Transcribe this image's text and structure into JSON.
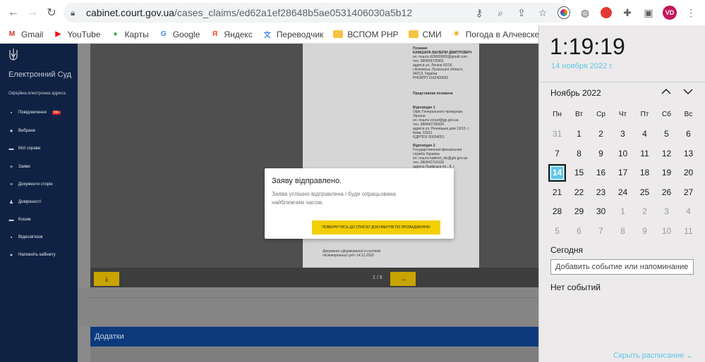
{
  "browser": {
    "url_host": "cabinet.court.gov.ua",
    "url_path": "/cases_claims/ed62a1ef28648b5ae0531406030a5b12",
    "avatar_initials": "VD"
  },
  "bookmarks": [
    {
      "label": "Gmail",
      "icon": "gmail-icon",
      "color": "#d93025",
      "glyph": "M"
    },
    {
      "label": "YouTube",
      "icon": "youtube-icon",
      "color": "#ff0000",
      "glyph": "▶"
    },
    {
      "label": "Карты",
      "icon": "maps-icon",
      "color": "#34a853",
      "glyph": "●"
    },
    {
      "label": "Google",
      "icon": "google-icon",
      "color": "#4285f4",
      "glyph": "G"
    },
    {
      "label": "Яндекс",
      "icon": "yandex-icon",
      "color": "#fc3f1d",
      "glyph": "Я"
    },
    {
      "label": "Переводчик",
      "icon": "translate-icon",
      "color": "#4285f4",
      "glyph": "文"
    },
    {
      "label": "ВСПОМ РНР",
      "icon": "folder-icon",
      "color": "#f6c343",
      "glyph": ""
    },
    {
      "label": "СМИ",
      "icon": "folder-icon",
      "color": "#f6c343",
      "glyph": ""
    },
    {
      "label": "Погода в Алчевске",
      "icon": "weather-icon",
      "color": "#f4a300",
      "glyph": "☀"
    }
  ],
  "site": {
    "title": "Електронний Суд",
    "subtitle": "Офіційна електронна адреса",
    "menu": [
      {
        "label": "Повідомлення",
        "icon": "message-icon",
        "glyph": "▪",
        "badge": "99+"
      },
      {
        "label": "Вибране",
        "icon": "star-icon",
        "glyph": "★",
        "badge": ""
      },
      {
        "label": "Мої справи",
        "icon": "folder-icon",
        "glyph": "▬",
        "badge": ""
      },
      {
        "label": "Заяви",
        "icon": "list-icon",
        "glyph": "≡",
        "badge": ""
      },
      {
        "label": "Документи сторін",
        "icon": "documents-icon",
        "glyph": "≡",
        "badge": ""
      },
      {
        "label": "Довіреності",
        "icon": "people-icon",
        "glyph": "♟",
        "badge": ""
      },
      {
        "label": "Кошик",
        "icon": "cart-icon",
        "glyph": "▬",
        "badge": ""
      },
      {
        "label": "Відеозв'язок",
        "icon": "video-icon",
        "glyph": "▪",
        "badge": ""
      },
      {
        "label": "Наповніть кабінету",
        "icon": "user-icon",
        "glyph": "●",
        "badge": ""
      }
    ]
  },
  "document": {
    "page_counter": "1 / 9",
    "lines": [
      "Позивач",
      "КАМШАРА ВАЛЕРІЙ ДМИТРОВИЧ",
      "ел. пошта d26009002@gmail.com",
      "тел. 380509725901",
      "адреса ул. Леніна б2/16",
      "г.Алчевськ, Луганської області,",
      "94213, Україна",
      "РНОКПП 2162400592",
      "Представник позивача",
      "Відповідач 1",
      "Офіс Генерального прокурора",
      "України",
      "ел. пошта vcourt@gp.gov.ua",
      "тел. 380442706624",
      "адреса ул. Резницька дом 13/15, г.",
      "Киев, 01011",
      "ЄДРПОУ 00034051",
      "Відповідач 2",
      "Государственная фискальная",
      "служба Украины",
      "ел. пошта kabinet_dis@gfs.gov.ua",
      "тел. 380442724109",
      "адреса Львівська пл., 8, г.",
      "Документ сформований в системі",
      "«Електронний суд» 14.11.2022"
    ]
  },
  "addons_label": "Додатки",
  "modal": {
    "title": "Заяву відправлено.",
    "text": "Заява успішно відправлена і буде опрацьована найближчим часом.",
    "button": "ПОВЕРНУТИСЬ ДО СПИСКУ ДОКУМЕНТІВ ПО ПРОВАДЖЕННЮ"
  },
  "clock": {
    "time": "1:19:19",
    "date": "14 ноября 2022 г.",
    "month": "Ноябрь 2022",
    "weekdays": [
      "Пн",
      "Вт",
      "Ср",
      "Чт",
      "Пт",
      "Сб",
      "Вс"
    ],
    "days": [
      {
        "d": "31",
        "dim": true
      },
      {
        "d": "1"
      },
      {
        "d": "2"
      },
      {
        "d": "3"
      },
      {
        "d": "4"
      },
      {
        "d": "5"
      },
      {
        "d": "6"
      },
      {
        "d": "7"
      },
      {
        "d": "8"
      },
      {
        "d": "9"
      },
      {
        "d": "10"
      },
      {
        "d": "11"
      },
      {
        "d": "12"
      },
      {
        "d": "13"
      },
      {
        "d": "14",
        "today": true
      },
      {
        "d": "15"
      },
      {
        "d": "16"
      },
      {
        "d": "17"
      },
      {
        "d": "18"
      },
      {
        "d": "19"
      },
      {
        "d": "20"
      },
      {
        "d": "21"
      },
      {
        "d": "22"
      },
      {
        "d": "23"
      },
      {
        "d": "24"
      },
      {
        "d": "25"
      },
      {
        "d": "26"
      },
      {
        "d": "27"
      },
      {
        "d": "28"
      },
      {
        "d": "29"
      },
      {
        "d": "30"
      },
      {
        "d": "1",
        "dim": true
      },
      {
        "d": "2",
        "dim": true
      },
      {
        "d": "3",
        "dim": true
      },
      {
        "d": "4",
        "dim": true
      },
      {
        "d": "5",
        "dim": true
      },
      {
        "d": "6",
        "dim": true
      },
      {
        "d": "7",
        "dim": true
      },
      {
        "d": "8",
        "dim": true
      },
      {
        "d": "9",
        "dim": true
      },
      {
        "d": "10",
        "dim": true
      },
      {
        "d": "11",
        "dim": true
      }
    ],
    "today_label": "Сегодня",
    "event_placeholder": "Добавить событие или напоминание",
    "no_events": "Нет событий",
    "hide_schedule": "Скрыть расписание"
  },
  "colors": {
    "accent_blue": "#5fc6e6",
    "site_navy": "#0f2244",
    "modal_button_yellow": "#f3cf00"
  }
}
